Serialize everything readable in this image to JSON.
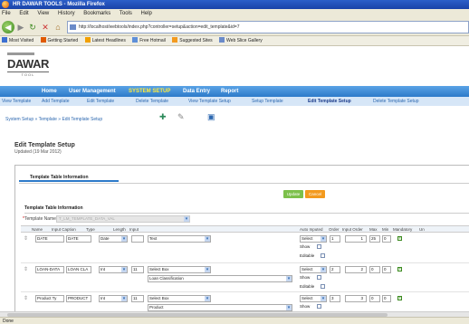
{
  "window": {
    "title": "HR DAWAR TOOLS - Mozilla Firefox"
  },
  "menu": [
    "File",
    "Edit",
    "View",
    "History",
    "Bookmarks",
    "Tools",
    "Help"
  ],
  "address": {
    "url": "http://localhost/webtools/index.php?controller=setup&action=edit_template&id=7"
  },
  "bookmarks": [
    {
      "label": "Most Visited",
      "color": "#3c6fd1"
    },
    {
      "label": "Getting Started",
      "color": "#e05a00"
    },
    {
      "label": "Latest Headlines",
      "color": "#f2a000"
    },
    {
      "label": "Free Hotmail",
      "color": "#5e8fd8"
    },
    {
      "label": "Suggested Sites",
      "color": "#f39a1e"
    },
    {
      "label": "Web Slice Gallery",
      "color": "#6b8bc9"
    }
  ],
  "logo": {
    "name": "DAWAR",
    "sub": "TOOL"
  },
  "mainnav": {
    "home": "Home",
    "user_management": "User Management",
    "system_setup": "SYSTEM SETUP",
    "data_entry": "Data Entry",
    "report": "Report"
  },
  "subnav": {
    "view_template": "View Template",
    "add_template": "Add Template",
    "edit_template": "Edit Template",
    "delete_template": "Delete Template",
    "view_template_setup": "View Template Setup",
    "setup_template": "Setup Template",
    "edit_template_setup": "Edit Template Setup",
    "delete_template_setup": "Delete Template Setup"
  },
  "breadcrumb": "System Setup » Template » Edit Template Setup",
  "page": {
    "title": "Edit Template Setup",
    "updated": "Updated (19 Mar 2012)"
  },
  "panel": {
    "tab": "Template Table Information",
    "update_label": "Update",
    "cancel_label": "Cancel",
    "section": "Template Table Information",
    "template_name_label": "Template Name",
    "template_name_value": "T_LM_TEMPLATE_DATA_VAL"
  },
  "grid": {
    "headers": [
      "Name",
      "Input Caption",
      "Type",
      "Length",
      "Input",
      "Auto Inputed",
      "Order",
      "Input Order",
      "Max",
      "Min",
      "Mandatory",
      "Un"
    ],
    "auto_labels": {
      "select": "Select",
      "show": "Show",
      "editable": "Editable"
    },
    "rows": [
      {
        "name": "DATE",
        "caption": "DATE",
        "type": "Date",
        "length": "",
        "input": "Text",
        "input2": "",
        "order": "1",
        "input_order": "1",
        "max": "25",
        "min": "0"
      },
      {
        "name": "LOAN-DATA",
        "caption": "LOAN CLA",
        "type": "Int",
        "length": "11",
        "input": "Select Box",
        "input2": "Loan Classification",
        "order": "2",
        "input_order": "2",
        "max": "0",
        "min": "0"
      },
      {
        "name": "Product Ty",
        "caption": "PRODUCT",
        "type": "Int",
        "length": "11",
        "input": "Select Box",
        "input2": "Product",
        "order": "3",
        "input_order": "3",
        "max": "0",
        "min": "0"
      }
    ]
  },
  "status": "Done"
}
